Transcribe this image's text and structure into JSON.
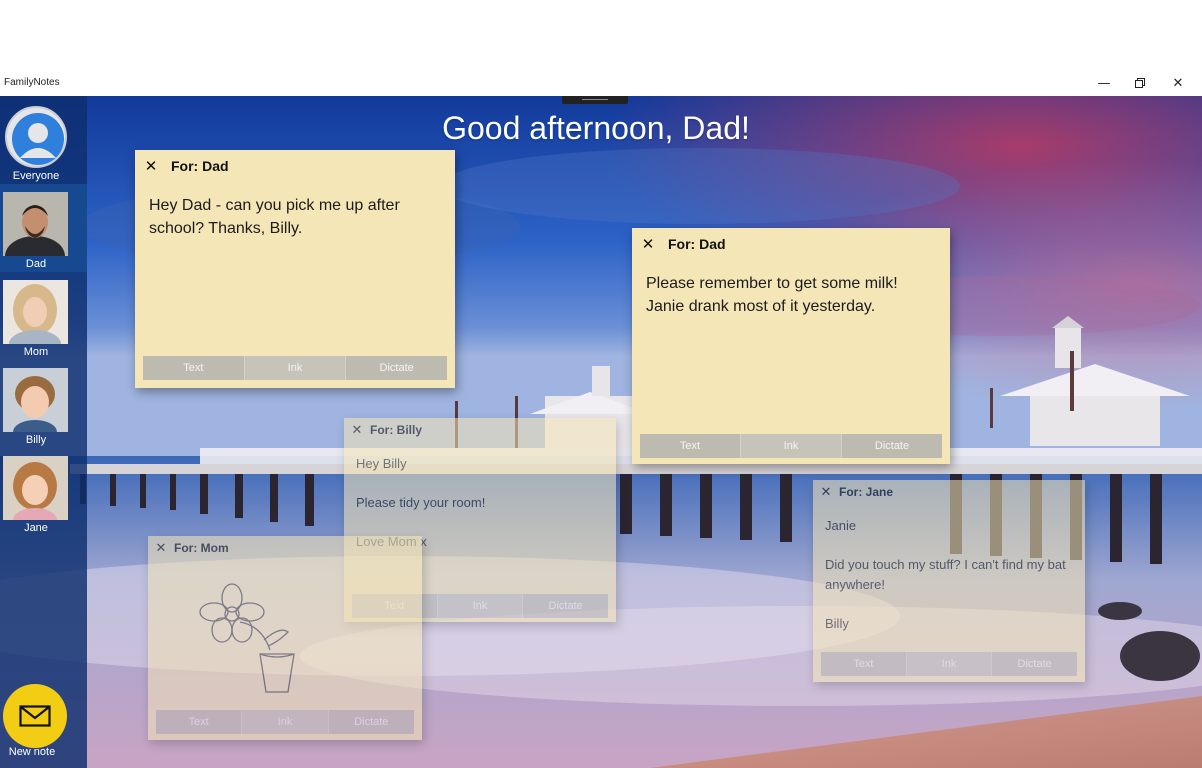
{
  "window": {
    "title": "FamilyNotes",
    "minimize_icon": "minimize-icon",
    "restore_icon": "restore-icon",
    "close_icon": "close-icon"
  },
  "greeting": "Good afternoon, Dad!",
  "sidebar": {
    "people": [
      {
        "name": "Everyone",
        "avatar": "generic-user-avatar",
        "selected": false
      },
      {
        "name": "Dad",
        "avatar": "dad-photo",
        "selected": true
      },
      {
        "name": "Mom",
        "avatar": "mom-photo",
        "selected": false
      },
      {
        "name": "Billy",
        "avatar": "billy-photo",
        "selected": false
      },
      {
        "name": "Jane",
        "avatar": "jane-photo",
        "selected": false
      }
    ],
    "new_note": {
      "label": "New note",
      "icon": "envelope-icon"
    }
  },
  "toolbar_labels": {
    "text": "Text",
    "ink": "Ink",
    "dictate": "Dictate"
  },
  "notes": [
    {
      "for": "For: Dad",
      "body": "Hey Dad - can you pick me up after school? Thanks, Billy.",
      "faded": false
    },
    {
      "for": "For: Dad",
      "body": "Please remember to get some milk! Janie drank most of it yesterday.",
      "faded": false
    },
    {
      "for": "For: Billy",
      "body": "Hey Billy\n\nPlease tidy your room!\n\nLove Mom x",
      "faded": true
    },
    {
      "for": "For: Jane",
      "body": "Janie\n\nDid you touch my stuff? I can't find my bat anywhere!\n\nBilly",
      "faded": true
    },
    {
      "for": "For: Mom",
      "body": "",
      "ink_drawing": "flower-in-pot-drawing",
      "faded": true
    }
  ],
  "colors": {
    "sidebar": "#0e2e6e",
    "sidebar_selected": "#184c94",
    "note": "#f5e6b7",
    "note_toolbar": "#bdbab0",
    "new_note_button": "#f3cd14"
  }
}
